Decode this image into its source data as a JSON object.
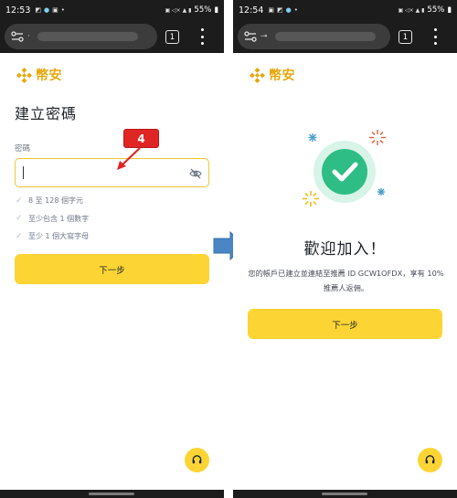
{
  "left_screen": {
    "status": {
      "time": "12:53",
      "battery": "55%",
      "tab_count": "1"
    },
    "logo_text": "幣安",
    "title": "建立密碼",
    "password_label": "密碼",
    "password_value": "",
    "rules": [
      "8 至 128 個字元",
      "至少包含 1 個數字",
      "至少 1 個大寫字母"
    ],
    "next_label": "下一步",
    "annotation_step": "4"
  },
  "right_screen": {
    "status": {
      "time": "12:54",
      "battery": "55%",
      "tab_count": "1"
    },
    "logo_text": "幣安",
    "welcome_title": "歡迎加入！",
    "welcome_desc": "您的帳戶已建立並連結至推薦 ID GCW1OFDX，享有 10% 推薦人返佣。",
    "next_label": "下一步"
  },
  "colors": {
    "brand_yellow": "#fcd535",
    "brand_gold": "#e6a70c",
    "success_green": "#2ebd85",
    "annotation_red": "#e02525",
    "arrow_blue": "#4a86c6"
  },
  "icons": [
    "settings-sliders-icon",
    "eye-off-icon",
    "check-icon",
    "headset-icon",
    "success-check-icon"
  ]
}
